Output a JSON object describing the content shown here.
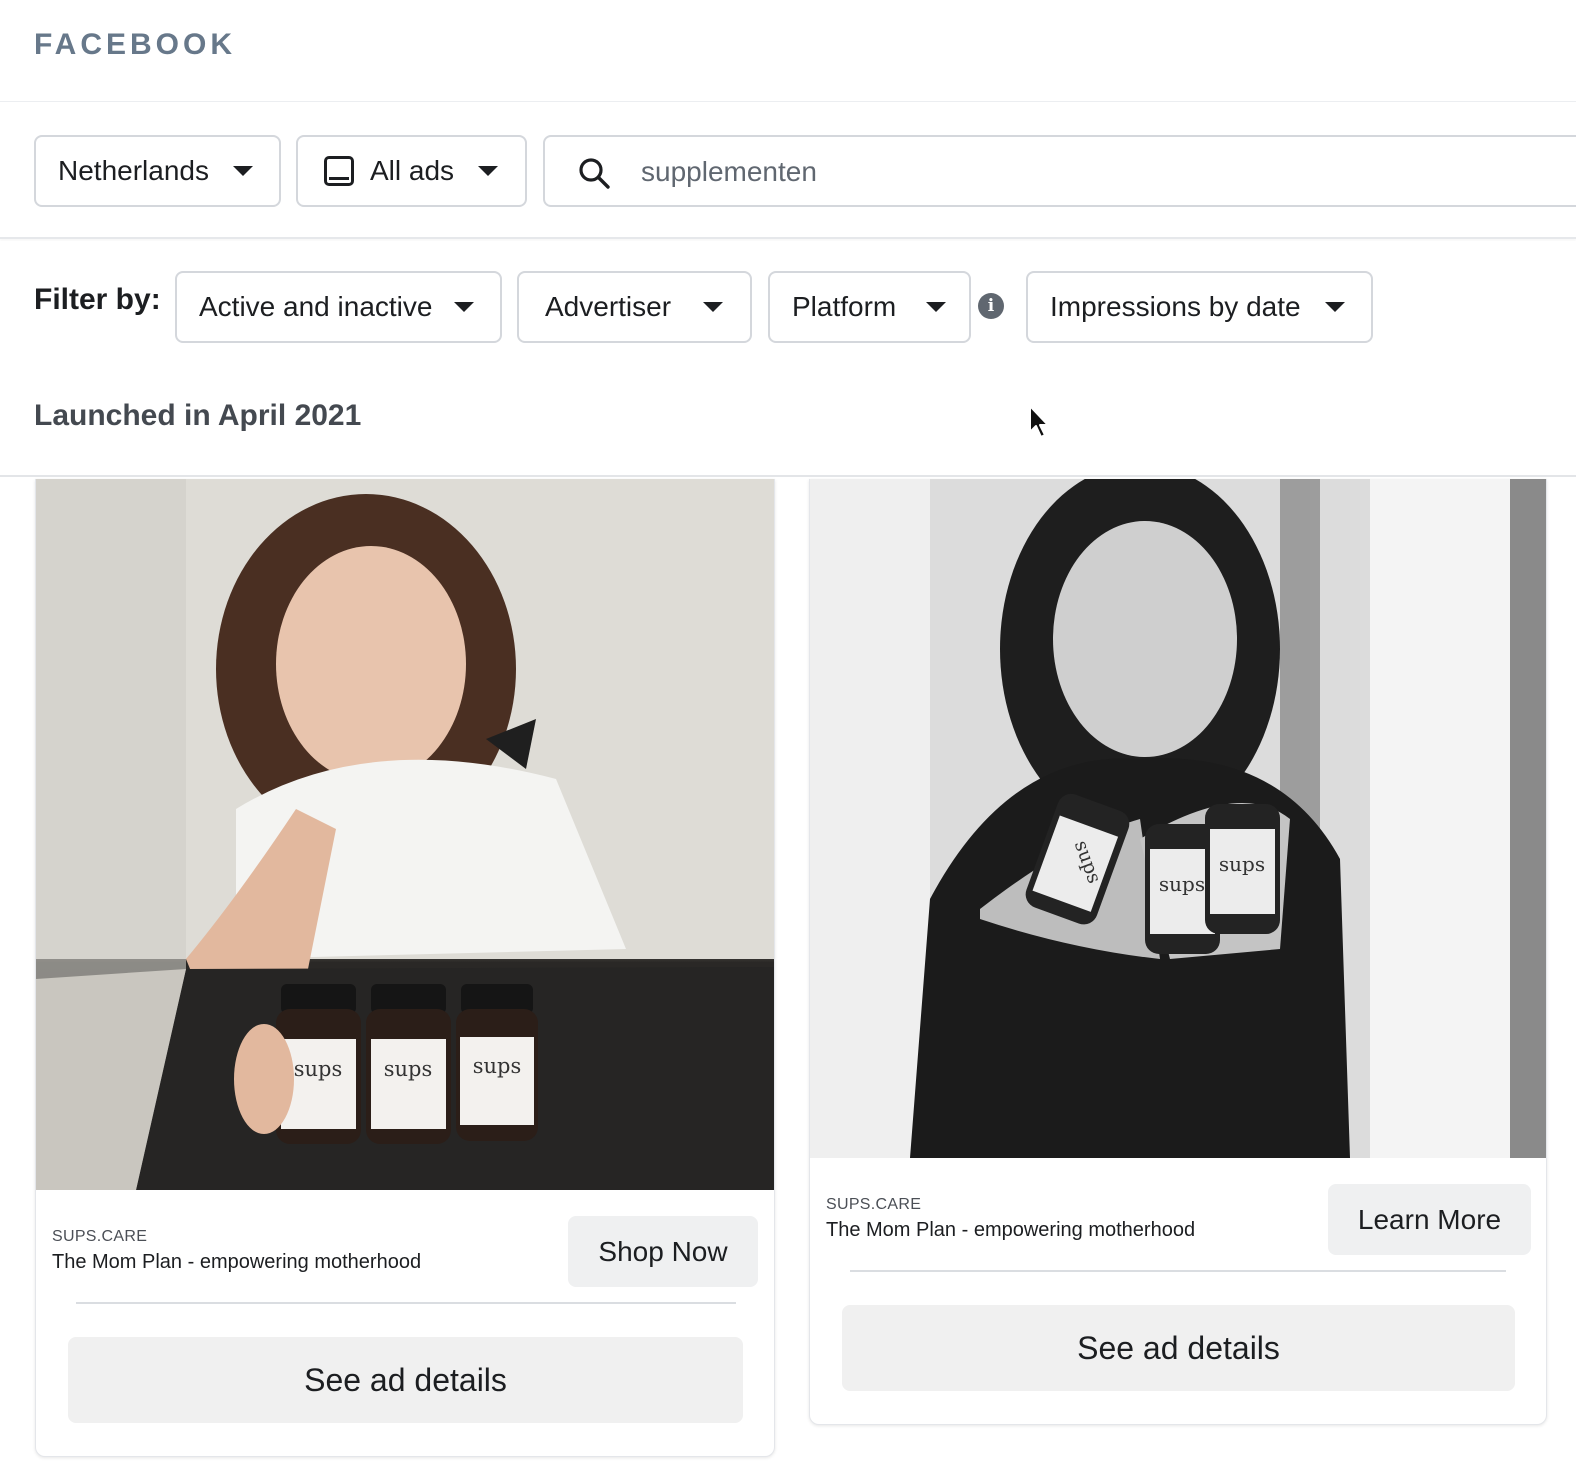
{
  "header": {
    "logo": "FACEBOOK"
  },
  "search_bar": {
    "country": "Netherlands",
    "ad_type": "All ads",
    "query": "supplementen"
  },
  "filters": {
    "label": "Filter by:",
    "status": "Active and inactive",
    "advertiser": "Advertiser",
    "platform": "Platform",
    "impressions": "Impressions by date"
  },
  "section": {
    "heading": "Launched in April 2021"
  },
  "ads": [
    {
      "advertiser_domain": "SUPS.CARE",
      "headline": "The Mom Plan - empowering motherhood",
      "cta": "Shop Now",
      "details_button": "See ad details",
      "bottle_labels": [
        "sups",
        "sups",
        "sups"
      ]
    },
    {
      "advertiser_domain": "SUPS.CARE",
      "headline": "The Mom Plan - empowering motherhood",
      "cta": "Learn More",
      "details_button": "See ad details",
      "bottle_labels": [
        "sups",
        "sups",
        "sups"
      ]
    }
  ],
  "colors": {
    "logo": "#67788a",
    "button_bg": "#eff0f1",
    "border": "#d4d7dc"
  },
  "icons": {
    "search": "search-icon",
    "info": "info-icon",
    "device": "device-icon",
    "caret": "caret-down-icon"
  }
}
